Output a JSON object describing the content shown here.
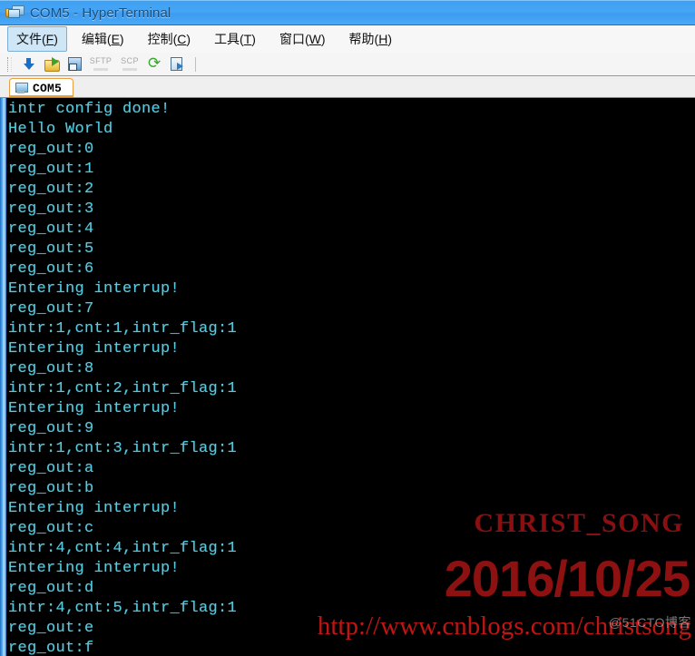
{
  "window": {
    "title": "COM5 - HyperTerminal",
    "icon": "serial-terminal-icon"
  },
  "menubar": {
    "items": [
      {
        "name": "file",
        "label_pre": "文件(",
        "accel": "F",
        "label_post": ")",
        "active": true
      },
      {
        "name": "edit",
        "label_pre": "编辑(",
        "accel": "E",
        "label_post": ")",
        "active": false
      },
      {
        "name": "control",
        "label_pre": "控制(",
        "accel": "C",
        "label_post": ")",
        "active": false
      },
      {
        "name": "tools",
        "label_pre": "工具(",
        "accel": "T",
        "label_post": ")",
        "active": false
      },
      {
        "name": "window",
        "label_pre": "窗口(",
        "accel": "W",
        "label_post": ")",
        "active": false
      },
      {
        "name": "help",
        "label_pre": "帮助(",
        "accel": "H",
        "label_post": ")",
        "active": false
      }
    ]
  },
  "toolbar": {
    "buttons": [
      {
        "name": "connect-button",
        "icon": "download-arrow-icon",
        "label": ""
      },
      {
        "name": "open-file-button",
        "icon": "open-folder-icon",
        "label": ""
      },
      {
        "name": "save-button",
        "icon": "floppy-disk-icon",
        "label": ""
      },
      {
        "name": "sftp-button",
        "icon": "sftp-text-icon",
        "label": "SFTP",
        "disabled": true
      },
      {
        "name": "scp-button",
        "icon": "scp-text-icon",
        "label": "SCP",
        "disabled": true
      },
      {
        "name": "reconnect-button",
        "icon": "refresh-arrow-icon",
        "label": ""
      },
      {
        "name": "properties-button",
        "icon": "properties-icon",
        "label": ""
      }
    ]
  },
  "tabs": [
    {
      "name": "tab-com5",
      "label": "COM5",
      "icon": "monitor-icon",
      "active": true
    }
  ],
  "terminal": {
    "lines": [
      "intr config done!",
      "Hello World",
      "reg_out:0",
      "reg_out:1",
      "reg_out:2",
      "reg_out:3",
      "reg_out:4",
      "reg_out:5",
      "reg_out:6",
      "Entering interrup!",
      "reg_out:7",
      "intr:1,cnt:1,intr_flag:1",
      "Entering interrup!",
      "reg_out:8",
      "intr:1,cnt:2,intr_flag:1",
      "Entering interrup!",
      "reg_out:9",
      "intr:1,cnt:3,intr_flag:1",
      "reg_out:a",
      "reg_out:b",
      "Entering interrup!",
      "reg_out:c",
      "intr:4,cnt:4,intr_flag:1",
      "Entering interrup!",
      "reg_out:d",
      "intr:4,cnt:5,intr_flag:1",
      "reg_out:e",
      "reg_out:f"
    ],
    "text_color": "#56cbe0",
    "background_color": "#000000"
  },
  "watermarks": {
    "brand": "CHRIST_SONG",
    "brand_color": "#8a0f10",
    "date": "2016/10/25",
    "date_color": "#8d1111",
    "url": "http://www.cnblogs.com/christsong",
    "url_color": "#c01515",
    "site_tag": "@51CTO博客"
  }
}
